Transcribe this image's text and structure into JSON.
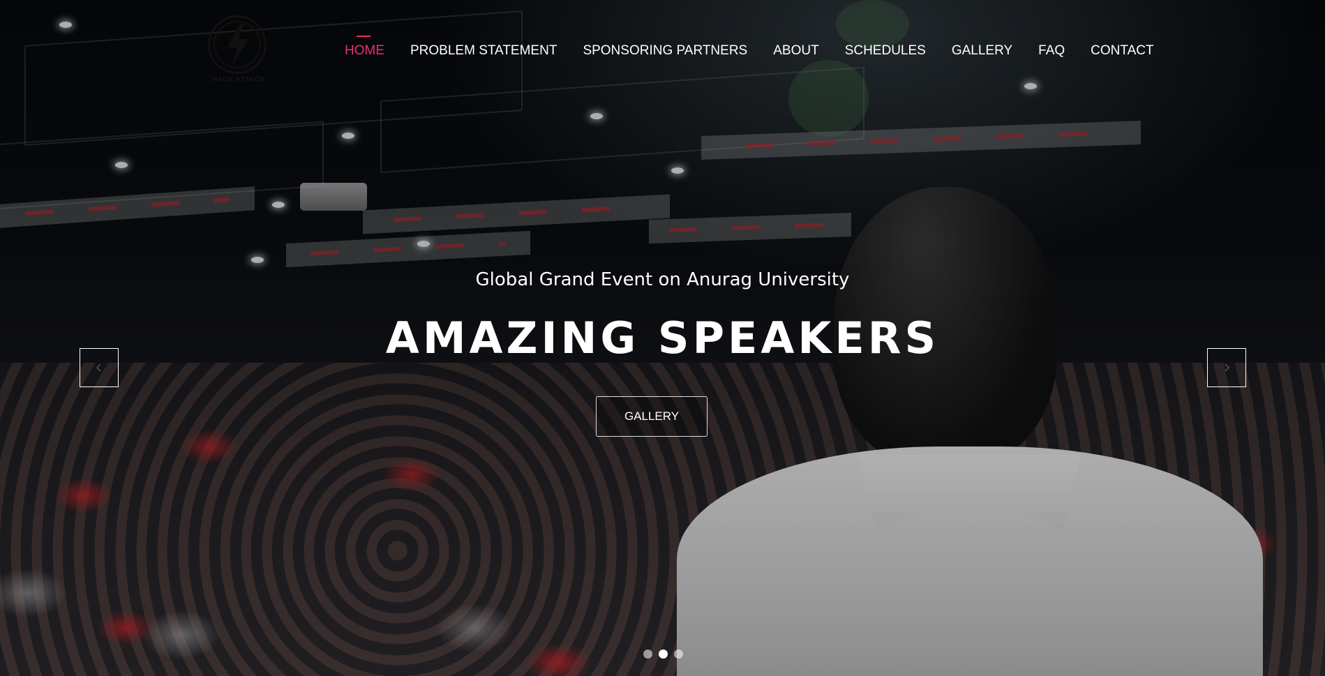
{
  "brand": {
    "logo_text": "HACK ATTACK"
  },
  "nav": {
    "items": [
      {
        "label": "HOME",
        "active": true
      },
      {
        "label": "PROBLEM STATEMENT",
        "active": false
      },
      {
        "label": "SPONSORING PARTNERS",
        "active": false
      },
      {
        "label": "ABOUT",
        "active": false
      },
      {
        "label": "SCHEDULES",
        "active": false
      },
      {
        "label": "GALLERY",
        "active": false
      },
      {
        "label": "FAQ",
        "active": false
      },
      {
        "label": "CONTACT",
        "active": false
      }
    ],
    "active_color": "#e8316e"
  },
  "hero": {
    "subtitle": "Global Grand Event on Anurag University",
    "headline": "AMAZING SPEAKERS",
    "cta_label": "GALLERY",
    "prev_icon": "chevron-left-icon",
    "next_icon": "chevron-right-icon"
  },
  "carousel": {
    "slides": 3,
    "active_slide": 2
  }
}
